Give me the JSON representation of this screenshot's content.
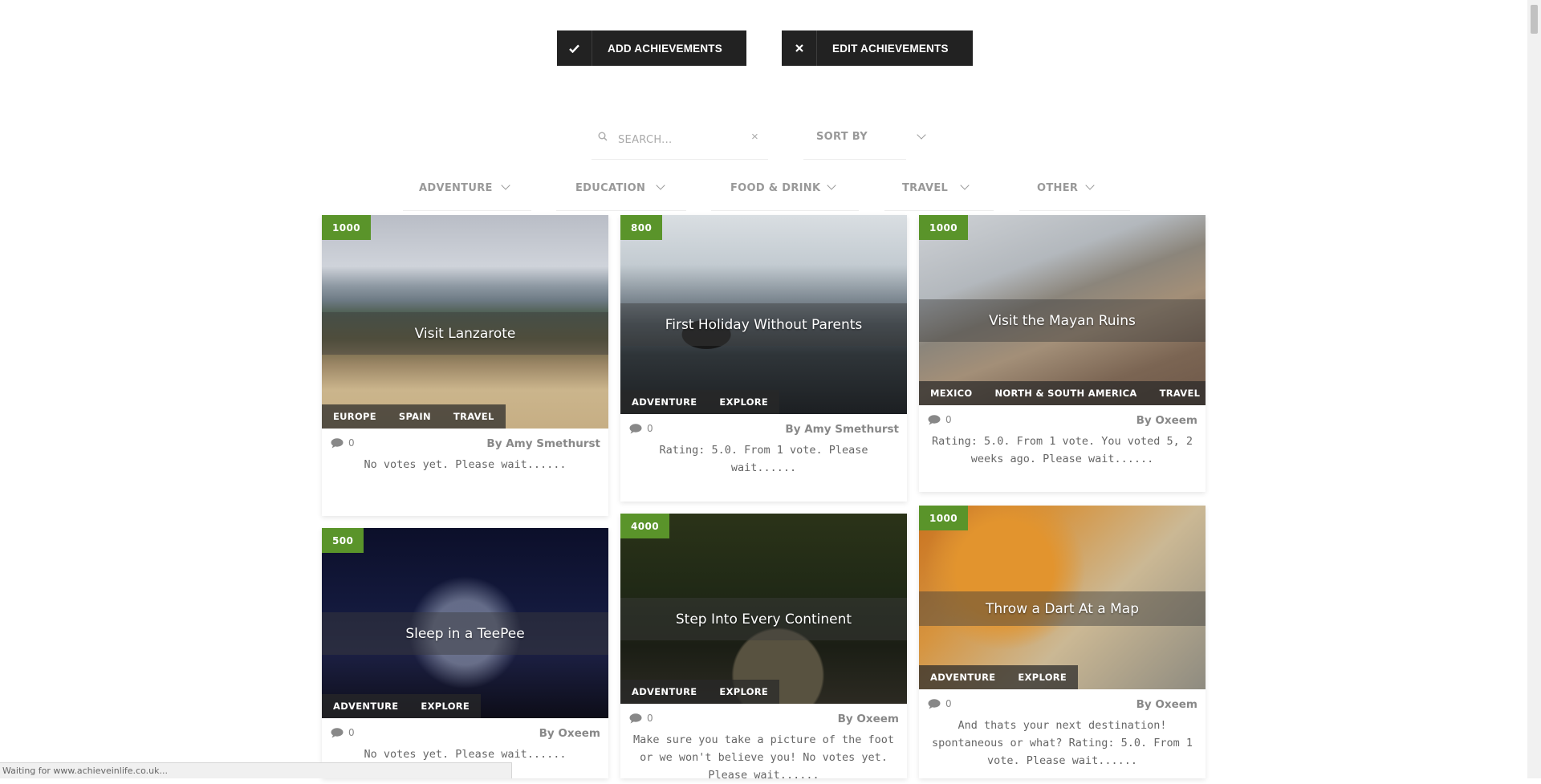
{
  "toolbar": {
    "add_label": "ADD ACHIEVEMENTS",
    "add_icon": "check-icon",
    "edit_label": "EDIT ACHIEVEMENTS",
    "edit_icon": "close-icon"
  },
  "search": {
    "placeholder": "SEARCH...",
    "clear_glyph": "×"
  },
  "sort": {
    "label": "SORT BY"
  },
  "filters": [
    {
      "label": "ADVENTURE"
    },
    {
      "label": "EDUCATION"
    },
    {
      "label": "FOOD & DRINK"
    },
    {
      "label": "TRAVEL"
    },
    {
      "label": "OTHER"
    }
  ],
  "cards": [
    {
      "points": "1000",
      "title": "Visit Lanzarote",
      "tags": [
        "EUROPE",
        "SPAIN",
        "TRAVEL"
      ],
      "comments": "0",
      "author": "By Amy Smethurst",
      "description": "No votes yet. Please wait......"
    },
    {
      "points": "800",
      "title": "First Holiday Without Parents",
      "tags": [
        "ADVENTURE",
        "EXPLORE"
      ],
      "comments": "0",
      "author": "By Amy Smethurst",
      "description": "Rating: 5.0. From 1 vote. Please wait......"
    },
    {
      "points": "1000",
      "title": "Visit the Mayan Ruins",
      "tags": [
        "MEXICO",
        "NORTH & SOUTH AMERICA",
        "TRAVEL"
      ],
      "comments": "0",
      "author": "By Oxeem",
      "description": "Rating: 5.0. From 1 vote. You voted 5, 2 weeks ago. Please wait......"
    },
    {
      "points": "500",
      "title": "Sleep in a TeePee",
      "tags": [
        "ADVENTURE",
        "EXPLORE"
      ],
      "comments": "0",
      "author": "By Oxeem",
      "description": "No votes yet. Please wait......"
    },
    {
      "points": "4000",
      "title": "Step Into Every Continent",
      "tags": [
        "ADVENTURE",
        "EXPLORE"
      ],
      "comments": "0",
      "author": "By Oxeem",
      "description": "Make sure you take a picture of the foot or we won't believe you! No votes yet. Please wait......"
    },
    {
      "points": "1000",
      "title": "Throw a Dart At a Map",
      "tags": [
        "ADVENTURE",
        "EXPLORE"
      ],
      "comments": "0",
      "author": "By Oxeem",
      "description": "And thats your next destination! spontaneous or what? Rating: 5.0. From 1 vote. Please wait......"
    }
  ],
  "status_bar": {
    "text": "Waiting for www.achieveinlife.co.uk..."
  },
  "colors": {
    "button_bg": "#222222",
    "points_badge": "#5a942a",
    "muted_text": "#999999"
  }
}
